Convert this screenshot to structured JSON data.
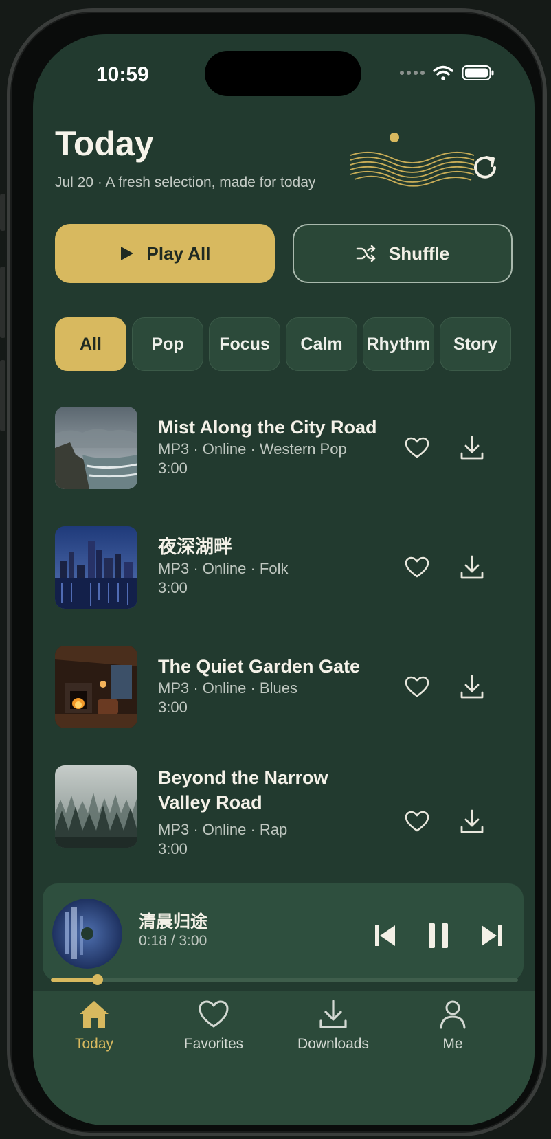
{
  "status": {
    "time": "10:59"
  },
  "header": {
    "title": "Today",
    "subtitle": "Jul 20 · A fresh selection, made for today"
  },
  "actions": {
    "play_all": "Play All",
    "shuffle": "Shuffle"
  },
  "filters": {
    "selected": "All",
    "items": [
      "All",
      "Pop",
      "Focus",
      "Calm",
      "Rhythm",
      "Story"
    ]
  },
  "tracks": [
    {
      "title": "Mist Along the City Road",
      "meta": "MP3 · Online · Western Pop",
      "duration": "3:00",
      "cover": "stormy-coast"
    },
    {
      "title": "夜深湖畔",
      "meta": "MP3 · Online · Folk",
      "duration": "3:00",
      "cover": "night-city-lake"
    },
    {
      "title": "The Quiet Garden Gate",
      "meta": "MP3 · Online · Blues",
      "duration": "3:00",
      "cover": "cabin-fireplace"
    },
    {
      "title": "Beyond the Narrow Valley Road",
      "meta": "MP3 · Online · Rap",
      "duration": "3:00",
      "cover": "misty-forest"
    }
  ],
  "now_playing": {
    "title": "清晨归途",
    "time": "0:18 / 3:00",
    "progress": 0.1
  },
  "tabs": [
    {
      "label": "Today",
      "icon": "home-icon",
      "active": true
    },
    {
      "label": "Favorites",
      "icon": "heart-icon",
      "active": false
    },
    {
      "label": "Downloads",
      "icon": "download-icon",
      "active": false
    },
    {
      "label": "Me",
      "icon": "person-icon",
      "active": false
    }
  ],
  "colors": {
    "accent": "#d8b95f",
    "background": "#223a2f",
    "surface": "#2c4a3a"
  }
}
